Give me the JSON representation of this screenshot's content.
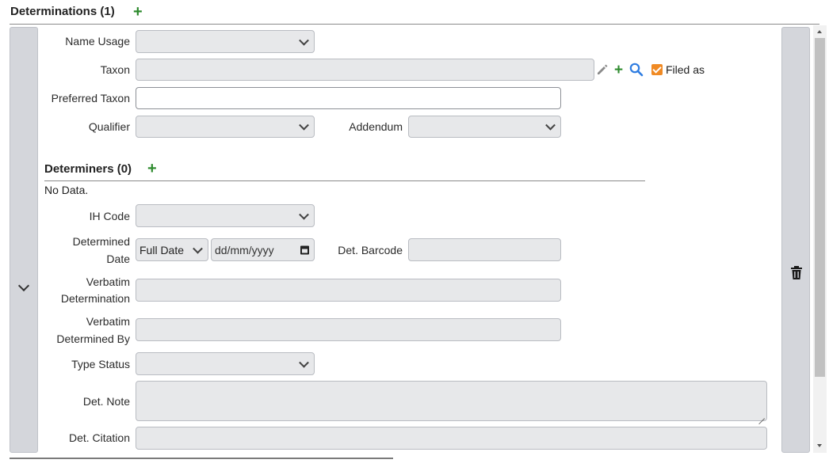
{
  "determinations": {
    "title": "Determinations (1)",
    "add_icon": "plus-icon"
  },
  "form": {
    "name_usage_label": "Name Usage",
    "taxon_label": "Taxon",
    "preferred_taxon_label": "Preferred Taxon",
    "qualifier_label": "Qualifier",
    "addendum_label": "Addendum",
    "filed_as_label": "Filed as",
    "filed_as_checked": true,
    "taxon_icons": [
      "pencil-icon",
      "plus-icon",
      "search-icon"
    ]
  },
  "determiners": {
    "title": "Determiners (0)",
    "empty_text": "No Data."
  },
  "details": {
    "ih_code_label": "IH Code",
    "determined_date_label_line1": "Determined",
    "determined_date_label_line2": "Date",
    "date_precision_value": "Full Date",
    "date_placeholder": "dd/mm/yyyy",
    "det_barcode_label": "Det. Barcode",
    "verbatim_determination_line1": "Verbatim",
    "verbatim_determination_line2": "Determination",
    "verbatim_determined_by_line1": "Verbatim",
    "verbatim_determined_by_line2": "Determined By",
    "type_status_label": "Type Status",
    "det_note_label": "Det. Note",
    "det_citation_label": "Det. Citation"
  },
  "colors": {
    "accent_green": "#2e8b2e",
    "search_blue": "#2f7de1",
    "checkbox_orange": "#f08a24",
    "field_bg": "#e7e8ea",
    "side_bar_bg": "#d4d6db"
  }
}
